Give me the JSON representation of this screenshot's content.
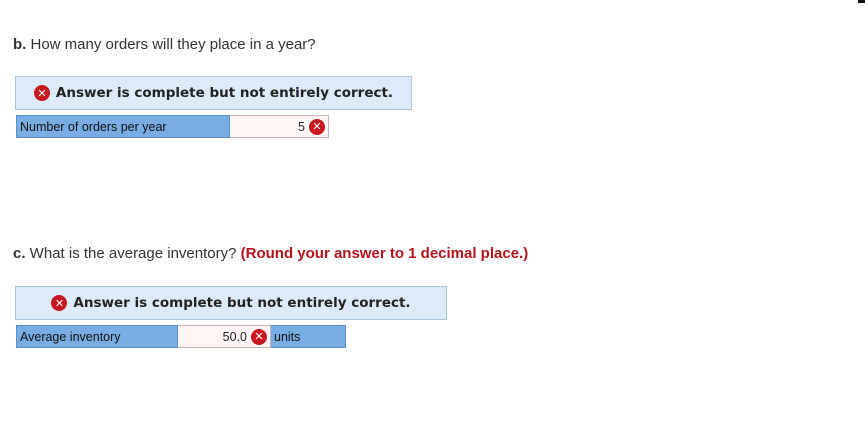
{
  "part_b": {
    "prefix": "b.",
    "question": " How many orders will they place in a year?",
    "banner": "Answer is complete but not entirely correct.",
    "row": {
      "label": "Number of orders per year",
      "value": "5",
      "status_icon": "incorrect-x-icon"
    }
  },
  "part_c": {
    "prefix": "c.",
    "question": " What is the average inventory? ",
    "hint": "(Round your answer to 1 decimal place.)",
    "banner": "Answer is complete but not entirely correct.",
    "row": {
      "label": "Average inventory",
      "value": "50.0",
      "unit": "units",
      "status_icon": "incorrect-x-icon"
    }
  },
  "colors": {
    "banner_bg": "#dcebf7",
    "label_cell_bg": "#78aee3",
    "error_red": "#c8181f",
    "hint_red": "#b3141c"
  }
}
